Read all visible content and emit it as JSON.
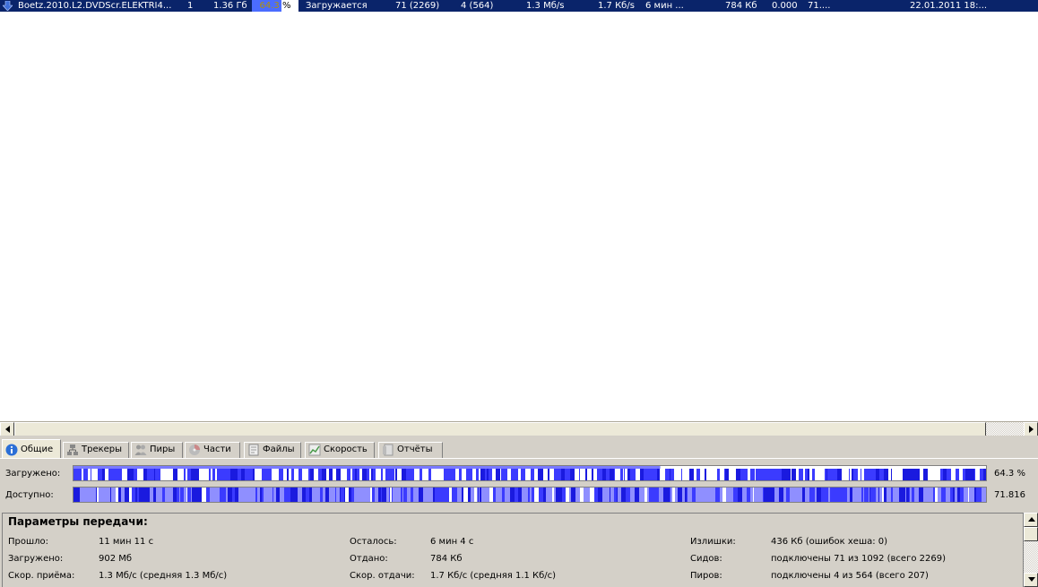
{
  "torrent_row": {
    "name": "Boetz.2010.L2.DVDScr.ELEKTRI4...",
    "number": "1",
    "size": "1.36 Гб",
    "progress_text": "64.3 %",
    "progress_value": 0.643,
    "status": "Загружается",
    "seeds": "71 (2269)",
    "peers": "4 (564)",
    "down_speed": "1.3 Мб/s",
    "up_speed": "1.7 Кб/s",
    "eta": "6 мин ...",
    "uploaded": "784 Кб",
    "ratio": "0.000",
    "availability": "71....",
    "added": "22.01.2011 18:...",
    "icon": "download-arrow-icon",
    "highlight_color": "#0a246a",
    "progress_color": "#4b6cff"
  },
  "tabs": [
    {
      "label": "Общие",
      "icon": "info-icon"
    },
    {
      "label": "Трекеры",
      "icon": "network-icon"
    },
    {
      "label": "Пиры",
      "icon": "people-icon"
    },
    {
      "label": "Части",
      "icon": "pieces-icon"
    },
    {
      "label": "Файлы",
      "icon": "files-icon"
    },
    {
      "label": "Скорость",
      "icon": "speed-graph-icon"
    },
    {
      "label": "Отчёты",
      "icon": "log-icon"
    }
  ],
  "downloaded_bar": {
    "label": "Загружено:",
    "value": "64.3 %",
    "fill": 0.643
  },
  "available_bar": {
    "label": "Доступно:",
    "value": "71.816"
  },
  "bar_colors": {
    "dark": "#1a1adf",
    "mid": "#3b3bff",
    "light": "#8f8fff",
    "top_strip": "#7a7aff"
  },
  "transfer": {
    "title": "Параметры передачи:",
    "elapsed_label": "Прошло:",
    "elapsed": "11 мин 11 с",
    "remaining_label": "Осталось:",
    "remaining": "6 мин 4 с",
    "wasted_label": "Излишки:",
    "wasted": "436 Кб (ошибок хеша: 0)",
    "downloaded_label": "Загружено:",
    "downloaded": "902 Мб",
    "uploaded_label": "Отдано:",
    "uploaded": "784 Кб",
    "seeds_label": "Сидов:",
    "seeds": "подключены 71 из 1092 (всего 2269)",
    "dl_speed_label": "Скор. приёма:",
    "dl_speed": "1.3 Мб/с (средняя 1.3 Мб/с)",
    "ul_speed_label": "Скор. отдачи:",
    "ul_speed": "1.7 Кб/с (средняя 1.1 Кб/с)",
    "peers_label": "Пиров:",
    "peers": "подключены 4 из 564 (всего 207)"
  }
}
